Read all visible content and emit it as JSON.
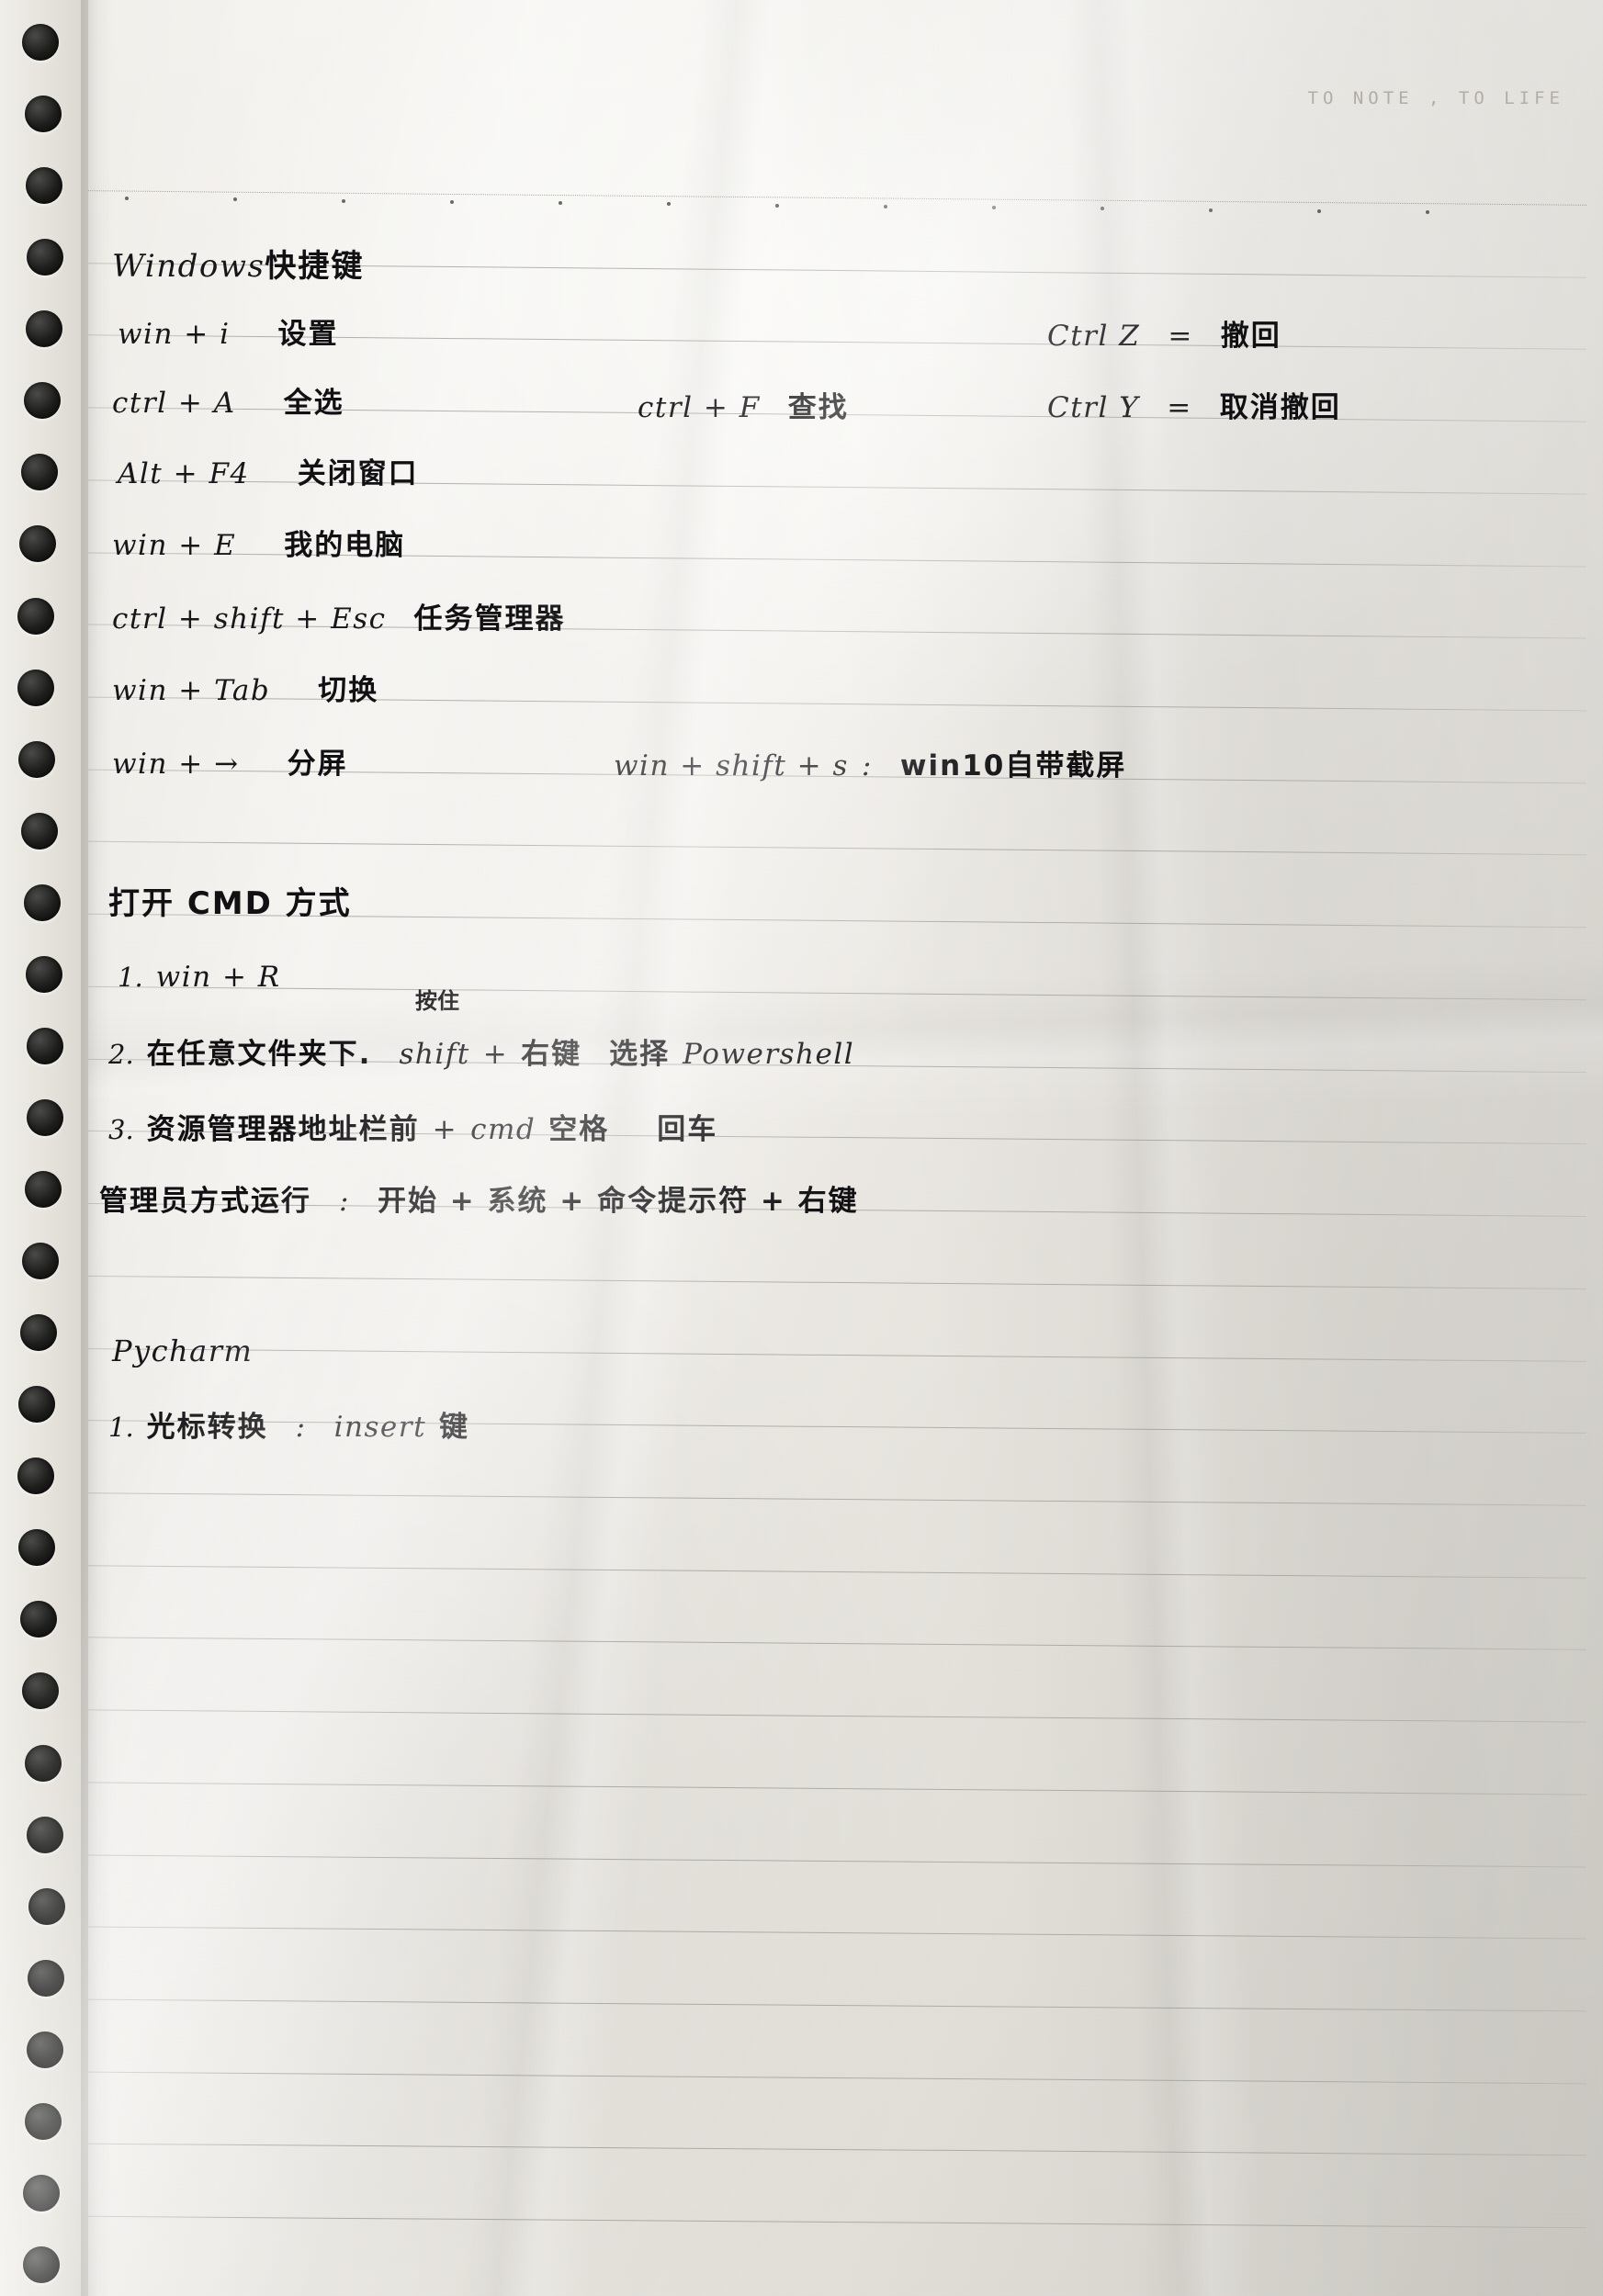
{
  "page": {
    "header_text": "TO NOTE , TO LIFE",
    "paper_color": "#eceae5",
    "ink_color": "#17171a",
    "rule_color": "#6e6c66",
    "hole_color": "#1c1c1b"
  },
  "sections": [
    {
      "id": "windows-shortcuts",
      "title": "Windows快捷键",
      "entries": [
        {
          "keys": "win + i",
          "desc": "设置"
        },
        {
          "keys": "ctrl + A",
          "desc": "全选"
        },
        {
          "keys": "Alt + F4",
          "desc": "关闭窗口"
        },
        {
          "keys": "win + E",
          "desc": "我的电脑"
        },
        {
          "keys": "ctrl + shift + Esc",
          "desc": "任务管理器"
        },
        {
          "keys": "win + Tab",
          "desc": "切换"
        },
        {
          "keys": "win + →",
          "desc": "分屏"
        }
      ],
      "middle_column": [
        {
          "keys": "ctrl + F",
          "desc": "查找"
        },
        {
          "keys": "win + shift + s",
          "sep": ":",
          "desc": "win10自带截屏"
        }
      ],
      "right_column": [
        {
          "keys": "Ctrl Z",
          "sep": "=",
          "desc": "撤回"
        },
        {
          "keys": "Ctrl Y",
          "sep": "=",
          "desc": "取消撤回"
        }
      ]
    },
    {
      "id": "open-cmd",
      "title": "打开 CMD 方式",
      "items": [
        {
          "num": "1.",
          "text": "win + R",
          "type": "latin"
        },
        {
          "num": "2.",
          "text_cjk_a": "在任意文件夹下.",
          "text_latin": "shift",
          "plus": "+",
          "text_cjk_b": "右键",
          "text_cjk_c": "选择",
          "text_latin_b": "Powershell",
          "annotation": "按住"
        },
        {
          "num": "3.",
          "text_cjk_a": "资源管理器地址栏前",
          "plus": "+",
          "text_latin": "cmd",
          "text_cjk_b": "空格",
          "text_cjk_c": "回车"
        }
      ],
      "admin_line": {
        "label": "管理员方式运行",
        "sep": ":",
        "value": "开始 + 系统 + 命令提示符 + 右键"
      }
    },
    {
      "id": "pycharm",
      "title": "Pycharm",
      "items": [
        {
          "num": "1.",
          "label": "光标转换",
          "sep": ":",
          "value_latin": "insert",
          "value_cjk": "键"
        }
      ]
    }
  ]
}
